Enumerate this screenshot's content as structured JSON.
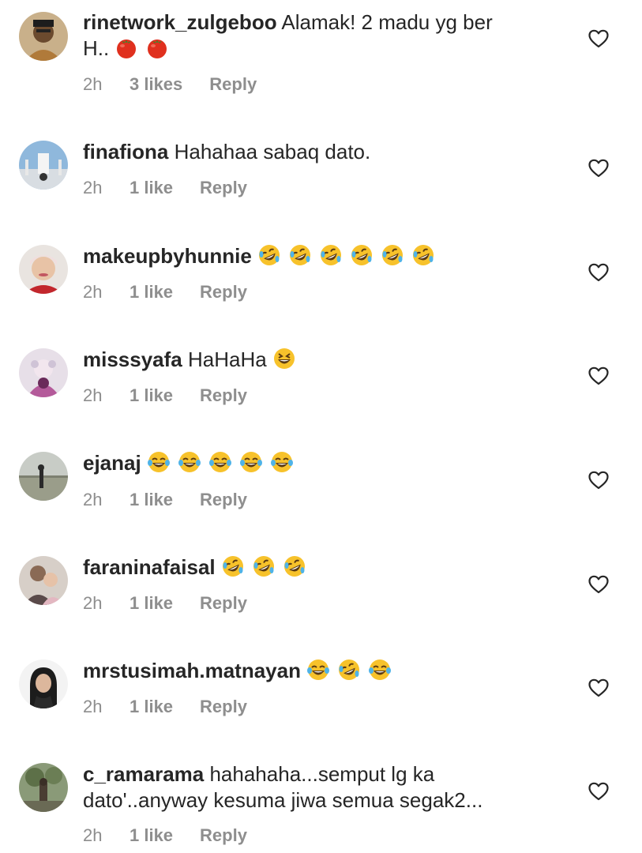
{
  "comments": [
    {
      "username": "rinetwork_zulgeboo",
      "text": "Alamak! 2 madu yg ber",
      "text2": "H..",
      "time": "2h",
      "likes": "3 likes",
      "reply": "Reply",
      "emojis": [
        "tomato-emoji",
        "tomato-emoji"
      ]
    },
    {
      "username": "finafiona",
      "text": "Hahahaa sabaq dato.",
      "time": "2h",
      "likes": "1 like",
      "reply": "Reply",
      "emojis": []
    },
    {
      "username": "makeupbyhunnie",
      "text": "",
      "time": "2h",
      "likes": "1 like",
      "reply": "Reply",
      "emojis": [
        "rofl-emoji",
        "rofl-emoji",
        "rofl-emoji",
        "rofl-emoji",
        "rofl-emoji",
        "rofl-emoji"
      ]
    },
    {
      "username": "misssyafa",
      "text": "HaHaHa",
      "time": "2h",
      "likes": "1 like",
      "reply": "Reply",
      "emojis": [
        "laughing-emoji"
      ]
    },
    {
      "username": "ejanaj",
      "text": "",
      "time": "2h",
      "likes": "1 like",
      "reply": "Reply",
      "emojis": [
        "joy-emoji",
        "joy-emoji",
        "joy-emoji",
        "joy-emoji",
        "joy-emoji"
      ]
    },
    {
      "username": "faraninafaisal",
      "text": "",
      "time": "2h",
      "likes": "1 like",
      "reply": "Reply",
      "emojis": [
        "rofl-emoji",
        "rofl-emoji",
        "rofl-emoji"
      ]
    },
    {
      "username": "mrstusimah.matnayan",
      "text": "",
      "time": "2h",
      "likes": "1 like",
      "reply": "Reply",
      "emojis": [
        "joy-emoji",
        "rofl-emoji",
        "joy-emoji"
      ]
    },
    {
      "username": "c_ramarama",
      "text": "hahahaha...semput lg ka",
      "text2": "dato'..anyway kesuma jiwa semua segak2...",
      "time": "2h",
      "likes": "1 like",
      "reply": "Reply",
      "emojis": []
    }
  ],
  "colors": {
    "text": "#262626",
    "meta": "#8e8e8e",
    "background": "#ffffff"
  },
  "icons": {
    "like": "heart-outline-icon"
  }
}
